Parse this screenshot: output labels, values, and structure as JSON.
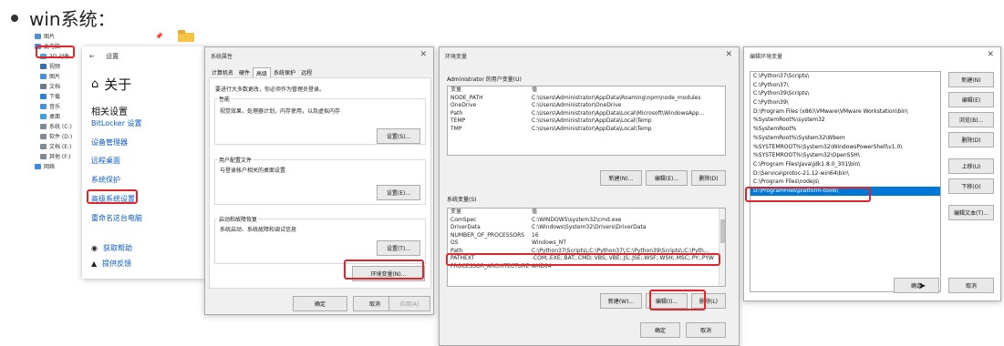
{
  "heading": "win系统：",
  "explorer": {
    "tree": [
      "图片",
      "此电脑",
      "3D 对象",
      "视频",
      "图片",
      "文档",
      "下载",
      "音乐",
      "桌面",
      "系统 (C:)",
      "软件 (D:)",
      "文档 (E:)",
      "其他 (F:)",
      "网络"
    ],
    "pin": "📌"
  },
  "settings": {
    "title": "设置",
    "back": "←",
    "about": "关于",
    "home_icon": "⌂",
    "related": "相关设置",
    "links": [
      "BitLocker 设置",
      "设备管理器",
      "远程桌面",
      "系统保护",
      "高级系统设置",
      "重命名这台电脑"
    ],
    "help": [
      {
        "icon": "◉",
        "label": "获取帮助"
      },
      {
        "icon": "▲",
        "label": "提供反馈"
      }
    ]
  },
  "sysprop": {
    "title": "系统属性",
    "close": "✕",
    "tabs": [
      "计算机名",
      "硬件",
      "高级",
      "系统保护",
      "远程"
    ],
    "admin_note": "要进行大多数更改，你必须作为管理员登录。",
    "groups": [
      {
        "label": "性能",
        "text": "视觉效果，处理器计划，内存使用，以及虚拟内存",
        "button": "设置(S)..."
      },
      {
        "label": "用户配置文件",
        "text": "与登录帐户相关的桌面设置",
        "button": "设置(E)..."
      },
      {
        "label": "启动和故障恢复",
        "text": "系统启动、系统故障和调试信息",
        "button": "设置(T)..."
      }
    ],
    "env_button": "环境变量(N)...",
    "ok": "确定",
    "cancel": "取消",
    "apply": "应用(A)"
  },
  "envvar": {
    "title": "环境变量",
    "close": "✕",
    "user_label": "Administrator 的用户变量(U)",
    "headers": [
      "变量",
      "值"
    ],
    "user_vars": [
      [
        "NODE_PATH",
        "C:\\Users\\Administrator\\AppData\\Roaming\\npm\\node_modules"
      ],
      [
        "OneDrive",
        "C:\\Users\\Administrator\\OneDrive"
      ],
      [
        "Path",
        "C:\\Users\\Administrator\\AppData\\Local\\Microsoft\\WindowsApp..."
      ],
      [
        "TEMP",
        "C:\\Users\\Administrator\\AppData\\Local\\Temp"
      ],
      [
        "TMP",
        "C:\\Users\\Administrator\\AppData\\Local\\Temp"
      ]
    ],
    "user_buttons": [
      "新建(N)...",
      "编辑(E)...",
      "删除(D)"
    ],
    "sys_label": "系统变量(S)",
    "sys_vars": [
      [
        "ComSpec",
        "C:\\WINDOWS\\system32\\cmd.exe"
      ],
      [
        "DriverData",
        "C:\\Windows\\System32\\Drivers\\DriverData"
      ],
      [
        "NUMBER_OF_PROCESSORS",
        "16"
      ],
      [
        "OS",
        "Windows_NT"
      ],
      [
        "Path",
        "C:\\Python37\\Scripts\\;C:\\Python37\\;C:\\Python39\\Scripts\\;C:\\Pyth..."
      ],
      [
        "PATHEXT",
        ".COM;.EXE;.BAT;.CMD;.VBS;.VBE;.JS;.JSE;.WSF;.WSH;.MSC;.PY;.PYW"
      ],
      [
        "PROCESSOR_ARCHITECTURE",
        "AMD64"
      ]
    ],
    "sys_buttons": [
      "新建(W)...",
      "编辑(I)...",
      "删除(L)"
    ],
    "ok": "确定",
    "cancel": "取消"
  },
  "editenv": {
    "title": "编辑环境变量",
    "close": "✕",
    "items": [
      "C:\\Python37\\Scripts\\",
      "C:\\Python37\\",
      "C:\\Python39\\Scripts\\",
      "C:\\Python39\\",
      "D:\\Program Files (x86)\\VMware\\VMware Workstation\\bin\\",
      "%SystemRoot%\\system32",
      "%SystemRoot%",
      "%SystemRoot%\\System32\\Wbem",
      "%SYSTEMROOT%\\System32\\WindowsPowerShell\\v1.0\\",
      "%SYSTEMROOT%\\System32\\OpenSSH\\",
      "C:\\Program Files\\Java\\jdk1.8.0_301\\bin\\",
      "D:\\Service\\protoc-21.12-win64\\bin\\",
      "C:\\Program Files\\nodejs\\",
      "D:\\ProgramFiles\\platform-tools\\"
    ],
    "buttons": [
      "新建(N)",
      "编辑(E)",
      "浏览(B)...",
      "删除(D)",
      "上移(U)",
      "下移(O)",
      "编辑文本(T)..."
    ],
    "ok": "确定",
    "cancel": "取消"
  },
  "colors": {
    "accent": "#0078d7",
    "highlight": "#e0252b",
    "link": "#0a5bc4"
  }
}
